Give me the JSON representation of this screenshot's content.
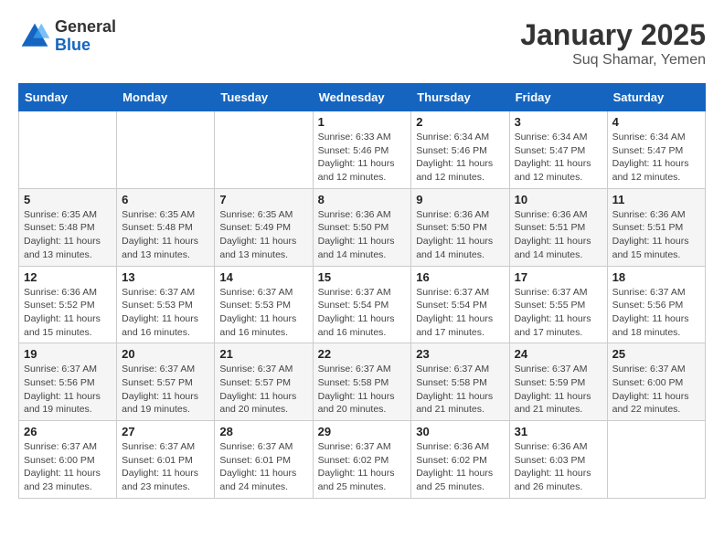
{
  "logo": {
    "general": "General",
    "blue": "Blue"
  },
  "title": "January 2025",
  "subtitle": "Suq Shamar, Yemen",
  "weekdays": [
    "Sunday",
    "Monday",
    "Tuesday",
    "Wednesday",
    "Thursday",
    "Friday",
    "Saturday"
  ],
  "weeks": [
    [
      {
        "day": "",
        "info": ""
      },
      {
        "day": "",
        "info": ""
      },
      {
        "day": "",
        "info": ""
      },
      {
        "day": "1",
        "sunrise": "6:33 AM",
        "sunset": "5:46 PM",
        "daylight": "11 hours and 12 minutes."
      },
      {
        "day": "2",
        "sunrise": "6:34 AM",
        "sunset": "5:46 PM",
        "daylight": "11 hours and 12 minutes."
      },
      {
        "day": "3",
        "sunrise": "6:34 AM",
        "sunset": "5:47 PM",
        "daylight": "11 hours and 12 minutes."
      },
      {
        "day": "4",
        "sunrise": "6:34 AM",
        "sunset": "5:47 PM",
        "daylight": "11 hours and 12 minutes."
      }
    ],
    [
      {
        "day": "5",
        "sunrise": "6:35 AM",
        "sunset": "5:48 PM",
        "daylight": "11 hours and 13 minutes."
      },
      {
        "day": "6",
        "sunrise": "6:35 AM",
        "sunset": "5:48 PM",
        "daylight": "11 hours and 13 minutes."
      },
      {
        "day": "7",
        "sunrise": "6:35 AM",
        "sunset": "5:49 PM",
        "daylight": "11 hours and 13 minutes."
      },
      {
        "day": "8",
        "sunrise": "6:36 AM",
        "sunset": "5:50 PM",
        "daylight": "11 hours and 14 minutes."
      },
      {
        "day": "9",
        "sunrise": "6:36 AM",
        "sunset": "5:50 PM",
        "daylight": "11 hours and 14 minutes."
      },
      {
        "day": "10",
        "sunrise": "6:36 AM",
        "sunset": "5:51 PM",
        "daylight": "11 hours and 14 minutes."
      },
      {
        "day": "11",
        "sunrise": "6:36 AM",
        "sunset": "5:51 PM",
        "daylight": "11 hours and 15 minutes."
      }
    ],
    [
      {
        "day": "12",
        "sunrise": "6:36 AM",
        "sunset": "5:52 PM",
        "daylight": "11 hours and 15 minutes."
      },
      {
        "day": "13",
        "sunrise": "6:37 AM",
        "sunset": "5:53 PM",
        "daylight": "11 hours and 16 minutes."
      },
      {
        "day": "14",
        "sunrise": "6:37 AM",
        "sunset": "5:53 PM",
        "daylight": "11 hours and 16 minutes."
      },
      {
        "day": "15",
        "sunrise": "6:37 AM",
        "sunset": "5:54 PM",
        "daylight": "11 hours and 16 minutes."
      },
      {
        "day": "16",
        "sunrise": "6:37 AM",
        "sunset": "5:54 PM",
        "daylight": "11 hours and 17 minutes."
      },
      {
        "day": "17",
        "sunrise": "6:37 AM",
        "sunset": "5:55 PM",
        "daylight": "11 hours and 17 minutes."
      },
      {
        "day": "18",
        "sunrise": "6:37 AM",
        "sunset": "5:56 PM",
        "daylight": "11 hours and 18 minutes."
      }
    ],
    [
      {
        "day": "19",
        "sunrise": "6:37 AM",
        "sunset": "5:56 PM",
        "daylight": "11 hours and 19 minutes."
      },
      {
        "day": "20",
        "sunrise": "6:37 AM",
        "sunset": "5:57 PM",
        "daylight": "11 hours and 19 minutes."
      },
      {
        "day": "21",
        "sunrise": "6:37 AM",
        "sunset": "5:57 PM",
        "daylight": "11 hours and 20 minutes."
      },
      {
        "day": "22",
        "sunrise": "6:37 AM",
        "sunset": "5:58 PM",
        "daylight": "11 hours and 20 minutes."
      },
      {
        "day": "23",
        "sunrise": "6:37 AM",
        "sunset": "5:58 PM",
        "daylight": "11 hours and 21 minutes."
      },
      {
        "day": "24",
        "sunrise": "6:37 AM",
        "sunset": "5:59 PM",
        "daylight": "11 hours and 21 minutes."
      },
      {
        "day": "25",
        "sunrise": "6:37 AM",
        "sunset": "6:00 PM",
        "daylight": "11 hours and 22 minutes."
      }
    ],
    [
      {
        "day": "26",
        "sunrise": "6:37 AM",
        "sunset": "6:00 PM",
        "daylight": "11 hours and 23 minutes."
      },
      {
        "day": "27",
        "sunrise": "6:37 AM",
        "sunset": "6:01 PM",
        "daylight": "11 hours and 23 minutes."
      },
      {
        "day": "28",
        "sunrise": "6:37 AM",
        "sunset": "6:01 PM",
        "daylight": "11 hours and 24 minutes."
      },
      {
        "day": "29",
        "sunrise": "6:37 AM",
        "sunset": "6:02 PM",
        "daylight": "11 hours and 25 minutes."
      },
      {
        "day": "30",
        "sunrise": "6:36 AM",
        "sunset": "6:02 PM",
        "daylight": "11 hours and 25 minutes."
      },
      {
        "day": "31",
        "sunrise": "6:36 AM",
        "sunset": "6:03 PM",
        "daylight": "11 hours and 26 minutes."
      },
      {
        "day": "",
        "info": ""
      }
    ]
  ],
  "labels": {
    "sunrise_prefix": "Sunrise: ",
    "sunset_prefix": "Sunset: ",
    "daylight_prefix": "Daylight: "
  }
}
